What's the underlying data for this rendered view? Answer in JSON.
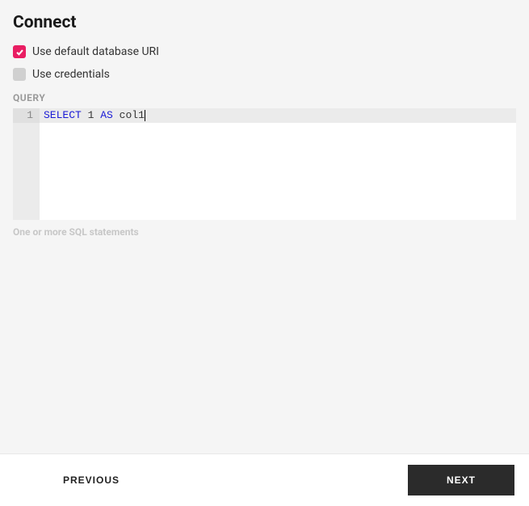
{
  "header": {
    "title": "Connect"
  },
  "options": {
    "use_default_uri": {
      "label": "Use default database URI",
      "checked": true
    },
    "use_credentials": {
      "label": "Use credentials",
      "checked": false
    }
  },
  "query": {
    "label": "QUERY",
    "line_number": "1",
    "tokens": {
      "select": "SELECT",
      "one": "1",
      "as": "AS",
      "col": "col1"
    },
    "hint": "One or more SQL statements"
  },
  "footer": {
    "previous": "PREVIOUS",
    "next": "NEXT"
  }
}
